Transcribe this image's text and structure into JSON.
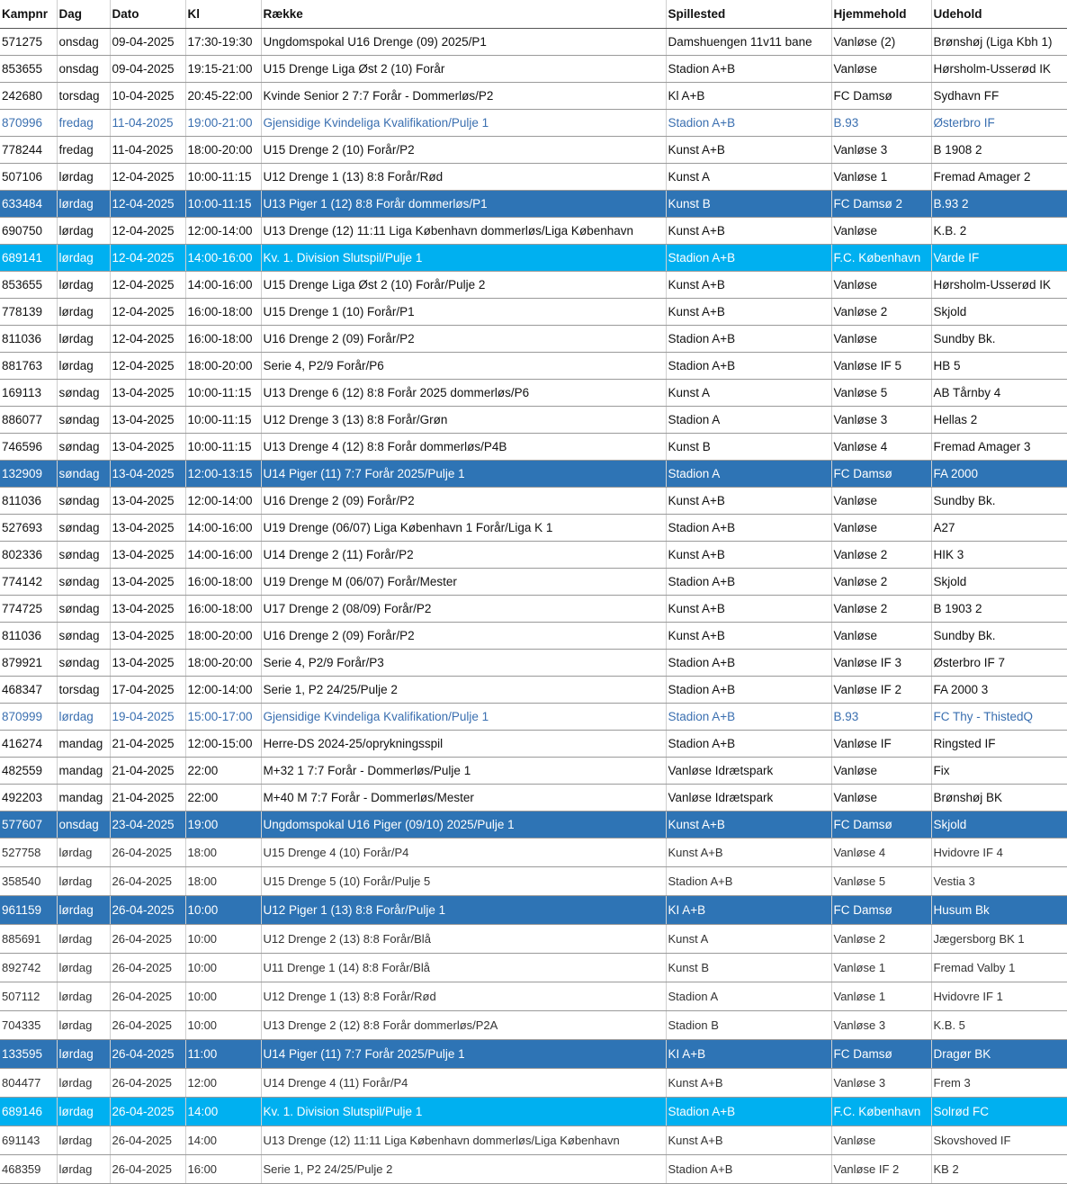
{
  "headers": [
    "Kampnr",
    "Dag",
    "Dato",
    "Kl",
    "Række",
    "Spillested",
    "Hjemmehold",
    "Udehold"
  ],
  "colors": {
    "highlight_dark": "#2e74b5",
    "highlight_light": "#00b0f0",
    "link_blue": "#3a6fb0"
  },
  "rows": [
    {
      "style": "normal",
      "cells": [
        "571275",
        "onsdag",
        "09-04-2025",
        "17:30-19:30",
        "Ungdomspokal U16 Drenge (09) 2025/P1",
        "Damshuengen 11v11 bane",
        "Vanløse (2)",
        "Brønshøj (Liga Kbh 1)"
      ]
    },
    {
      "style": "normal",
      "cells": [
        "853655",
        "onsdag",
        "09-04-2025",
        "19:15-21:00",
        "U15 Drenge Liga Øst 2 (10) Forår",
        "Stadion A+B",
        "Vanløse",
        "Hørsholm-Usserød IK"
      ]
    },
    {
      "style": "normal",
      "cells": [
        "242680",
        "torsdag",
        "10-04-2025",
        "20:45-22:00",
        "Kvinde Senior 2 7:7 Forår - Dommerløs/P2",
        "Kl A+B",
        "FC Damsø",
        "Sydhavn FF"
      ]
    },
    {
      "style": "blue",
      "cells": [
        "870996",
        "fredag",
        "11-04-2025",
        "19:00-21:00",
        "Gjensidige Kvindeliga Kvalifikation/Pulje 1",
        "Stadion A+B",
        "B.93",
        "Østerbro IF"
      ]
    },
    {
      "style": "normal",
      "cells": [
        "778244",
        "fredag",
        "11-04-2025",
        "18:00-20:00",
        "U15 Drenge 2 (10) Forår/P2",
        "Kunst A+B",
        "Vanløse 3",
        "B 1908 2"
      ]
    },
    {
      "style": "normal",
      "cells": [
        "507106",
        "lørdag",
        "12-04-2025",
        "10:00-11:15",
        "U12 Drenge 1 (13) 8:8 Forår/Rød",
        "Kunst A",
        "Vanløse 1",
        "Fremad Amager 2"
      ]
    },
    {
      "style": "hl-dark",
      "cells": [
        "633484",
        "lørdag",
        "12-04-2025",
        "10:00-11:15",
        "U13 Piger 1 (12) 8:8 Forår dommerløs/P1",
        "Kunst B",
        "FC Damsø 2",
        "B.93 2"
      ]
    },
    {
      "style": "normal",
      "cells": [
        "690750",
        "lørdag",
        "12-04-2025",
        "12:00-14:00",
        "U13 Drenge (12) 11:11 Liga København dommerløs/Liga København",
        "Kunst A+B",
        "Vanløse",
        "K.B. 2"
      ]
    },
    {
      "style": "hl-light",
      "cells": [
        "689141",
        "lørdag",
        "12-04-2025",
        "14:00-16:00",
        "Kv. 1. Division Slutspil/Pulje 1",
        "Stadion A+B",
        "F.C. København",
        "Varde IF"
      ]
    },
    {
      "style": "normal",
      "cells": [
        "853655",
        "lørdag",
        "12-04-2025",
        "14:00-16:00",
        "U15 Drenge Liga Øst 2 (10) Forår/Pulje 2",
        "Kunst A+B",
        "Vanløse",
        "Hørsholm-Usserød IK"
      ]
    },
    {
      "style": "normal",
      "cells": [
        "778139",
        "lørdag",
        "12-04-2025",
        "16:00-18:00",
        "U15 Drenge 1 (10) Forår/P1",
        "Kunst A+B",
        "Vanløse 2",
        "Skjold"
      ]
    },
    {
      "style": "normal",
      "cells": [
        "811036",
        "lørdag",
        "12-04-2025",
        "16:00-18:00",
        "U16 Drenge 2 (09) Forår/P2",
        "Stadion A+B",
        "Vanløse",
        "Sundby Bk."
      ]
    },
    {
      "style": "normal",
      "cells": [
        "881763",
        "lørdag",
        "12-04-2025",
        "18:00-20:00",
        "Serie 4, P2/9 Forår/P6",
        "Stadion A+B",
        "Vanløse IF 5",
        "HB 5"
      ]
    },
    {
      "style": "normal",
      "cells": [
        "169113",
        "søndag",
        "13-04-2025",
        "10:00-11:15",
        "U13 Drenge 6 (12) 8:8 Forår 2025 dommerløs/P6",
        "Kunst A",
        "Vanløse 5",
        "AB Tårnby 4"
      ]
    },
    {
      "style": "normal",
      "cells": [
        "886077",
        "søndag",
        "13-04-2025",
        "10:00-11:15",
        "U12 Drenge 3 (13) 8:8 Forår/Grøn",
        "Stadion A",
        "Vanløse 3",
        "Hellas 2"
      ]
    },
    {
      "style": "normal",
      "cells": [
        "746596",
        "søndag",
        "13-04-2025",
        "10:00-11:15",
        "U13 Drenge 4 (12) 8:8 Forår dommerløs/P4B",
        "Kunst B",
        "Vanløse 4",
        "Fremad Amager 3"
      ]
    },
    {
      "style": "hl-dark",
      "cells": [
        "132909",
        "søndag",
        "13-04-2025",
        "12:00-13:15",
        "U14 Piger (11) 7:7 Forår 2025/Pulje 1",
        "Stadion A",
        "FC Damsø",
        "FA 2000"
      ]
    },
    {
      "style": "normal",
      "cells": [
        "811036",
        "søndag",
        "13-04-2025",
        "12:00-14:00",
        "U16 Drenge 2 (09) Forår/P2",
        "Kunst A+B",
        "Vanløse",
        "Sundby Bk."
      ]
    },
    {
      "style": "normal",
      "cells": [
        "527693",
        "søndag",
        "13-04-2025",
        "14:00-16:00",
        "U19 Drenge (06/07) Liga København 1 Forår/Liga K 1",
        "Stadion A+B",
        "Vanløse",
        "A27"
      ]
    },
    {
      "style": "normal",
      "cells": [
        "802336",
        "søndag",
        "13-04-2025",
        "14:00-16:00",
        "U14 Drenge 2 (11) Forår/P2",
        "Kunst A+B",
        "Vanløse 2",
        "HIK 3"
      ]
    },
    {
      "style": "normal",
      "cells": [
        "774142",
        "søndag",
        "13-04-2025",
        "16:00-18:00",
        "U19 Drenge M (06/07) Forår/Mester",
        "Stadion A+B",
        "Vanløse 2",
        "Skjold"
      ]
    },
    {
      "style": "normal",
      "cells": [
        "774725",
        "søndag",
        "13-04-2025",
        "16:00-18:00",
        "U17 Drenge 2 (08/09) Forår/P2",
        "Kunst A+B",
        "Vanløse 2",
        "B 1903 2"
      ]
    },
    {
      "style": "normal",
      "cells": [
        "811036",
        "søndag",
        "13-04-2025",
        "18:00-20:00",
        "U16 Drenge 2 (09) Forår/P2",
        "Kunst A+B",
        "Vanløse",
        "Sundby Bk."
      ]
    },
    {
      "style": "normal",
      "cells": [
        "879921",
        "søndag",
        "13-04-2025",
        "18:00-20:00",
        "Serie 4, P2/9 Forår/P3",
        "Stadion A+B",
        "Vanløse  IF 3",
        "Østerbro IF 7"
      ]
    },
    {
      "style": "normal",
      "cells": [
        "468347",
        "torsdag",
        "17-04-2025",
        "12:00-14:00",
        "Serie 1, P2 24/25/Pulje 2",
        "Stadion A+B",
        "Vanløse IF 2",
        "FA 2000 3"
      ]
    },
    {
      "style": "blue",
      "cells": [
        "870999",
        "lørdag",
        "19-04-2025",
        "15:00-17:00",
        "Gjensidige Kvindeliga Kvalifikation/Pulje 1",
        "Stadion A+B",
        "B.93",
        "FC Thy - ThistedQ"
      ]
    },
    {
      "style": "normal",
      "cells": [
        "416274",
        "mandag",
        "21-04-2025",
        "12:00-15:00",
        "Herre-DS 2024-25/oprykningsspil",
        "Stadion A+B",
        "Vanløse IF",
        "Ringsted IF"
      ]
    },
    {
      "style": "normal",
      "cells": [
        "482559",
        "mandag",
        "21-04-2025",
        "22:00",
        "M+32 1 7:7 Forår - Dommerløs/Pulje 1",
        "Vanløse Idrætspark",
        "Vanløse",
        "Fix"
      ]
    },
    {
      "style": "normal",
      "cells": [
        "492203",
        "mandag",
        "21-04-2025",
        "22:00",
        "M+40 M 7:7 Forår - Dommerløs/Mester",
        "Vanløse Idrætspark",
        "Vanløse",
        "Brønshøj BK"
      ]
    },
    {
      "style": "hl-dark",
      "cells": [
        "577607",
        "onsdag",
        "23-04-2025",
        "19:00",
        "Ungdomspokal U16 Piger (09/10) 2025/Pulje 1",
        "Kunst A+B",
        "FC Damsø",
        "Skjold"
      ]
    },
    {
      "style": "gray",
      "cells": [
        "527758",
        "lørdag",
        "26-04-2025",
        "18:00",
        "U15 Drenge 4 (10) Forår/P4",
        "Kunst A+B",
        "Vanløse 4",
        "Hvidovre IF 4"
      ]
    },
    {
      "style": "gray",
      "cells": [
        "358540",
        "lørdag",
        "26-04-2025",
        "18:00",
        "U15 Drenge 5 (10) Forår/Pulje 5",
        "Stadion A+B",
        "Vanløse 5",
        "Vestia 3"
      ]
    },
    {
      "style": "hl-dark",
      "cells": [
        "961159",
        "lørdag",
        "26-04-2025",
        "10:00",
        "U12 Piger 1 (13) 8:8 Forår/Pulje 1",
        "KI A+B",
        "FC Damsø",
        "Husum Bk"
      ]
    },
    {
      "style": "gray",
      "cells": [
        "885691",
        "lørdag",
        "26-04-2025",
        "10:00",
        "U12 Drenge 2 (13) 8:8 Forår/Blå",
        "Kunst A",
        "Vanløse 2",
        "Jægersborg BK 1"
      ]
    },
    {
      "style": "gray",
      "cells": [
        "892742",
        "lørdag",
        "26-04-2025",
        "10:00",
        "U11 Drenge 1 (14) 8:8 Forår/Blå",
        "Kunst B",
        "Vanløse 1",
        "Fremad Valby 1"
      ]
    },
    {
      "style": "gray",
      "cells": [
        "507112",
        "lørdag",
        "26-04-2025",
        "10:00",
        "U12 Drenge 1 (13) 8:8 Forår/Rød",
        "Stadion A",
        "Vanløse 1",
        "Hvidovre IF 1"
      ]
    },
    {
      "style": "gray",
      "cells": [
        "704335",
        "lørdag",
        "26-04-2025",
        "10:00",
        "U13 Drenge 2 (12) 8:8 Forår dommerløs/P2A",
        "Stadion B",
        "Vanløse 3",
        "K.B. 5"
      ]
    },
    {
      "style": "hl-dark",
      "cells": [
        "133595",
        "lørdag",
        "26-04-2025",
        "11:00",
        "U14 Piger (11) 7:7 Forår 2025/Pulje 1",
        "KI A+B",
        "FC Damsø",
        "Dragør BK"
      ]
    },
    {
      "style": "gray",
      "cells": [
        "804477",
        "lørdag",
        "26-04-2025",
        "12:00",
        "U14 Drenge 4 (11) Forår/P4",
        "Kunst A+B",
        "Vanløse 3",
        "Frem 3"
      ]
    },
    {
      "style": "hl-light",
      "cells": [
        "689146",
        "lørdag",
        "26-04-2025",
        "14:00",
        "Kv. 1. Division Slutspil/Pulje 1",
        "Stadion A+B",
        "F.C. København",
        "Solrød FC"
      ]
    },
    {
      "style": "gray",
      "cells": [
        "691143",
        "lørdag",
        "26-04-2025",
        "14:00",
        "U13 Drenge (12) 11:11 Liga København dommerløs/Liga København",
        "Kunst A+B",
        "Vanløse",
        "Skovshoved IF"
      ]
    },
    {
      "style": "gray",
      "cells": [
        "468359",
        "lørdag",
        "26-04-2025",
        "16:00",
        "Serie 1, P2 24/25/Pulje 2",
        "Stadion A+B",
        "Vanløse IF 2",
        "KB 2"
      ]
    }
  ]
}
